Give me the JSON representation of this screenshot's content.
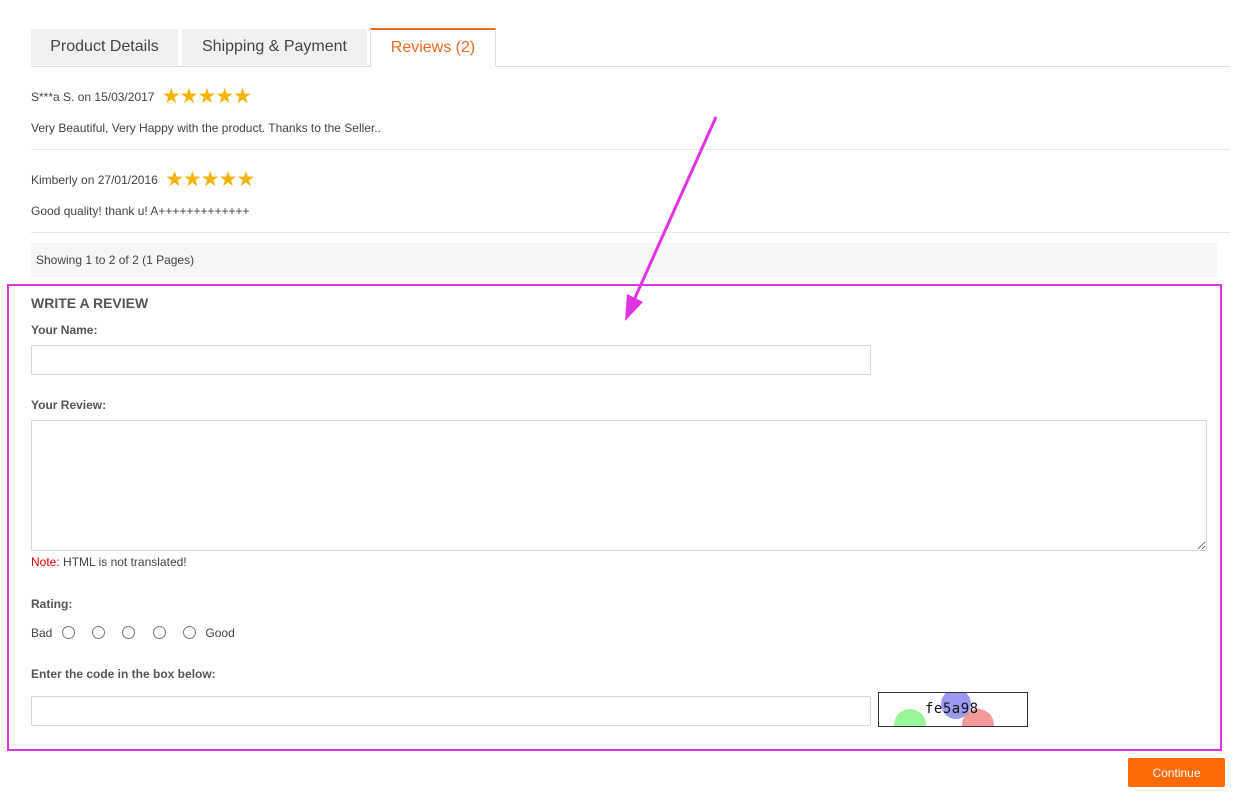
{
  "tabs": [
    {
      "label": "Product Details",
      "active": false
    },
    {
      "label": "Shipping & Payment",
      "active": false
    },
    {
      "label": "Reviews (2)",
      "active": true
    }
  ],
  "reviews": [
    {
      "author": "S***a S.",
      "on": "on",
      "date": "15/03/2017",
      "stars": "★★★★★",
      "rating": 5,
      "text": "Very Beautiful, Very Happy with the product. Thanks to the Seller.."
    },
    {
      "author": "Kimberly",
      "on": "on",
      "date": "27/01/2016",
      "stars": "★★★★★",
      "rating": 5,
      "text": "Good quality! thank u! A+++++++++++++"
    }
  ],
  "pagination": {
    "text": "Showing 1 to 2 of 2 (1 Pages)"
  },
  "form": {
    "heading": "WRITE A REVIEW",
    "name_label": "Your Name:",
    "name_value": "",
    "review_label": "Your Review:",
    "review_value": "",
    "note_prefix": "Note:",
    "note_text": " HTML is not translated!",
    "rating_label": "Rating:",
    "rating_bad": "Bad",
    "rating_good": "Good",
    "captcha_label": "Enter the code in the box below:",
    "captcha_value": "",
    "captcha_code": "fe5a98",
    "continue_label": "Continue"
  },
  "colors": {
    "accent": "#ee6a1e",
    "button": "#ff6a07",
    "star": "#f5b301",
    "highlight": "#e233e2",
    "note_red": "#d40000"
  }
}
